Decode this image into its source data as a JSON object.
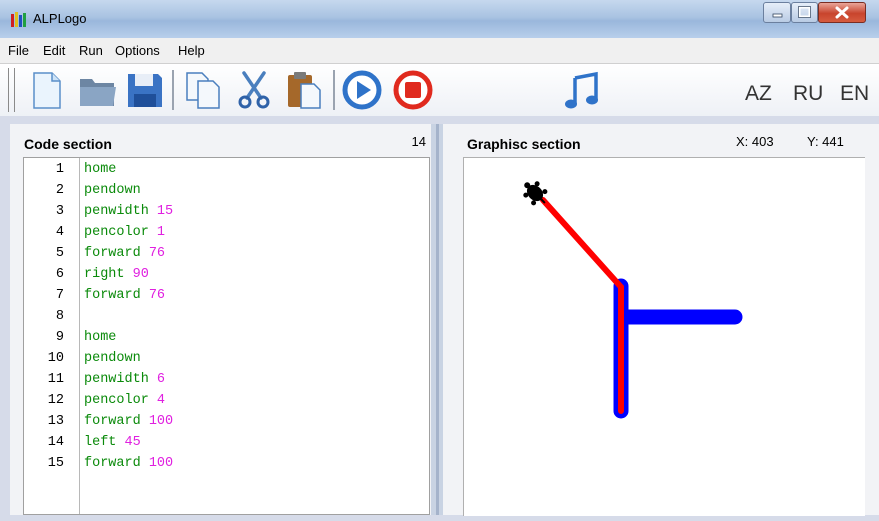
{
  "window": {
    "title": "ALPLogo"
  },
  "menu": {
    "file": "File",
    "edit": "Edit",
    "run": "Run",
    "options": "Options",
    "help": "Help"
  },
  "toolbar": {
    "icons": [
      "new-file-icon",
      "open-folder-icon",
      "save-icon",
      "copy-icon",
      "cut-icon",
      "paste-icon",
      "run-icon",
      "stop-icon",
      "music-icon"
    ],
    "languages": [
      "AZ",
      "RU",
      "EN"
    ]
  },
  "code_section": {
    "title": "Code section",
    "line_count": "14",
    "lines": [
      {
        "n": "1",
        "kw": "home",
        "arg": ""
      },
      {
        "n": "2",
        "kw": "pendown",
        "arg": ""
      },
      {
        "n": "3",
        "kw": "penwidth",
        "arg": "15"
      },
      {
        "n": "4",
        "kw": "pencolor",
        "arg": "1"
      },
      {
        "n": "5",
        "kw": "forward",
        "arg": "76"
      },
      {
        "n": "6",
        "kw": "right",
        "arg": "90"
      },
      {
        "n": "7",
        "kw": "forward",
        "arg": "76"
      },
      {
        "n": "8",
        "kw": "",
        "arg": ""
      },
      {
        "n": "9",
        "kw": "home",
        "arg": ""
      },
      {
        "n": "10",
        "kw": "pendown",
        "arg": ""
      },
      {
        "n": "11",
        "kw": "penwidth",
        "arg": "6"
      },
      {
        "n": "12",
        "kw": "pencolor",
        "arg": "4"
      },
      {
        "n": "13",
        "kw": "forward",
        "arg": "100"
      },
      {
        "n": "14",
        "kw": "left",
        "arg": "45"
      },
      {
        "n": "15",
        "kw": "forward",
        "arg": "100"
      }
    ]
  },
  "graphics_section": {
    "title": "Graphisc section",
    "x_label": "X: 403",
    "y_label": "Y: 441"
  },
  "colors": {
    "pen_blue": "#0000ff",
    "pen_red": "#ff0000",
    "keyword": "#0a8a0a",
    "argument": "#e020e0"
  }
}
